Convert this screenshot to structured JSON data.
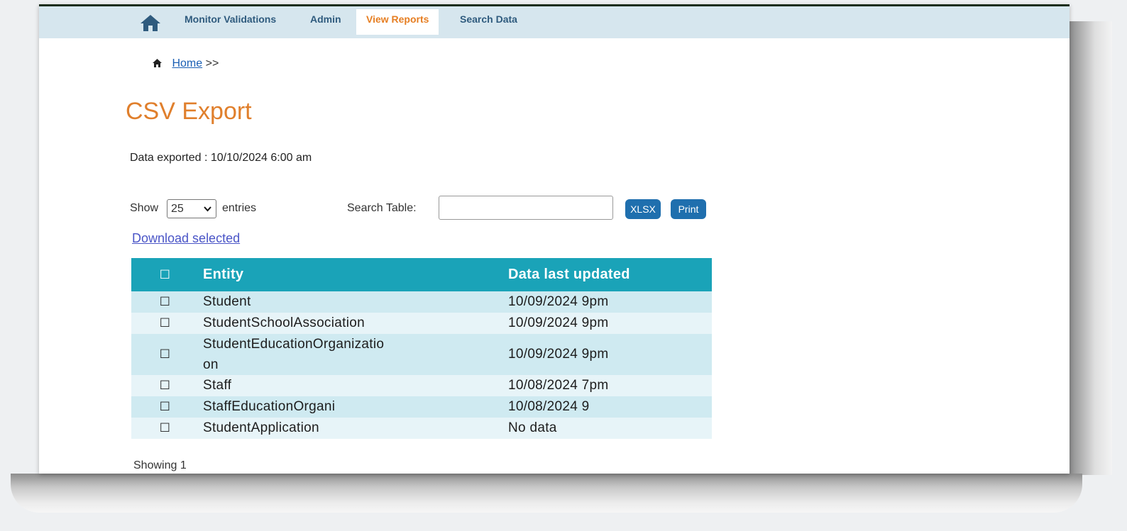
{
  "nav": {
    "items": [
      {
        "label": "Monitor Validations",
        "active": false
      },
      {
        "label": "Admin",
        "active": false
      },
      {
        "label": "View Reports",
        "active": true
      },
      {
        "label": "Search Data",
        "active": false
      }
    ]
  },
  "breadcrumb": {
    "home": "Home",
    "separator": ">>"
  },
  "page": {
    "title": "CSV Export",
    "export_info": "Data exported : 10/10/2024 6:00 am"
  },
  "controls": {
    "show_label": "Show",
    "entries_value": "25",
    "entries_label": "entries",
    "search_label": "Search Table:",
    "search_value": "",
    "xlsx_label": "XLSX",
    "print_label": "Print",
    "download_selected": "Download selected"
  },
  "table": {
    "headers": {
      "select": "☐",
      "entity": "Entity",
      "updated": "Data last updated"
    },
    "rows": [
      {
        "checkbox": "☐",
        "entity": "Student",
        "updated": "10/09/2024 9pm"
      },
      {
        "checkbox": "☐",
        "entity": "StudentSchoolAssociation",
        "updated": "10/09/2024 9pm"
      },
      {
        "checkbox": "☐",
        "entity": "StudentEducationOrganizatio\non",
        "updated": "10/09/2024 9pm"
      },
      {
        "checkbox": "☐",
        "entity": "Staff",
        "updated": "10/08/2024 7pm"
      },
      {
        "checkbox": "☐",
        "entity": "StaffEducationOrgani",
        "updated": "10/08/2024 9"
      },
      {
        "checkbox": "☐",
        "entity": "StudentApplication",
        "updated": "No data"
      }
    ]
  },
  "footer": {
    "info": "Showing 1"
  },
  "colors": {
    "accent": "#e07f2c",
    "table_header": "#1aa3b8",
    "nav_bg": "#d6e6ee",
    "button": "#1f6fae"
  }
}
